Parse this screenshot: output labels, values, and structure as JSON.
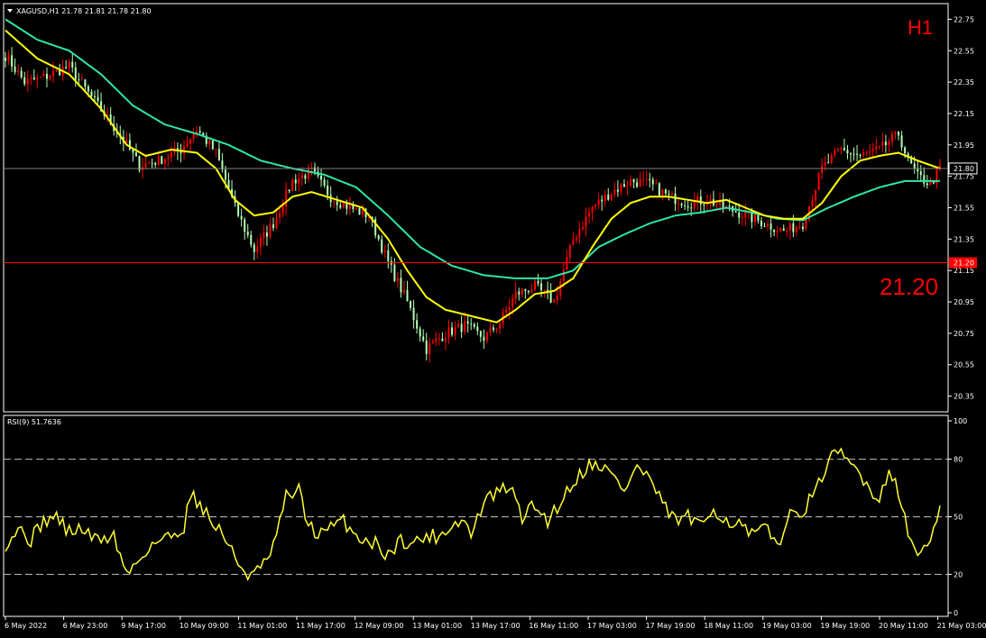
{
  "header": {
    "menu_icon": "triangle-down-icon",
    "title_text": "XAGUSD,H1  21.78 21.81 21.78 21.80"
  },
  "timeframe_label": "H1",
  "level_label": "21.20",
  "colors": {
    "background": "#000000",
    "bull": "#ff0000",
    "bear": "#b3ffb3",
    "fast_ma": "#ffff00",
    "slow_ma": "#2ee6a8",
    "rsi": "#ffff33",
    "level": "#ff0000",
    "bid": "#808080",
    "frame": "#ffffff"
  },
  "chart_data": [
    {
      "type": "line",
      "title": "XAGUSD,H1",
      "ylim": [
        20.25,
        22.85
      ],
      "y_ticks": [
        "22.75",
        "22.55",
        "22.35",
        "22.15",
        "21.95",
        "21.75",
        "21.55",
        "21.35",
        "21.15",
        "20.95",
        "20.75",
        "20.55",
        "20.35"
      ],
      "x_tick_labels": [
        "6 May 2022",
        "6 May 23:00",
        "9 May 17:00",
        "10 May 09:00",
        "11 May 01:00",
        "11 May 17:00",
        "12 May 09:00",
        "13 May 01:00",
        "13 May 17:00",
        "16 May 11:00",
        "17 May 03:00",
        "17 May 19:00",
        "18 May 11:00",
        "19 May 03:00",
        "19 May 19:00",
        "20 May 11:00",
        "21 May 03:00"
      ],
      "current_price": "21.80",
      "current_price_value": 21.8,
      "horizontal_level": "21.20",
      "horizontal_level_value": 21.2,
      "series": [
        {
          "name": "close",
          "anchors": [
            [
              0,
              22.52
            ],
            [
              6,
              22.35
            ],
            [
              12,
              22.38
            ],
            [
              20,
              22.45
            ],
            [
              26,
              22.28
            ],
            [
              32,
              22.12
            ],
            [
              38,
              21.95
            ],
            [
              42,
              21.82
            ],
            [
              48,
              21.85
            ],
            [
              55,
              21.92
            ],
            [
              60,
              22.05
            ],
            [
              66,
              21.9
            ],
            [
              72,
              21.55
            ],
            [
              78,
              21.28
            ],
            [
              84,
              21.45
            ],
            [
              90,
              21.72
            ],
            [
              96,
              21.78
            ],
            [
              102,
              21.62
            ],
            [
              108,
              21.55
            ],
            [
              114,
              21.5
            ],
            [
              120,
              21.2
            ],
            [
              126,
              20.95
            ],
            [
              132,
              20.65
            ],
            [
              138,
              20.75
            ],
            [
              144,
              20.8
            ],
            [
              150,
              20.72
            ],
            [
              155,
              20.82
            ],
            [
              160,
              21.0
            ],
            [
              166,
              21.05
            ],
            [
              172,
              20.95
            ],
            [
              178,
              21.35
            ],
            [
              184,
              21.55
            ],
            [
              190,
              21.65
            ],
            [
              196,
              21.72
            ],
            [
              202,
              21.7
            ],
            [
              208,
              21.62
            ],
            [
              214,
              21.58
            ],
            [
              220,
              21.6
            ],
            [
              226,
              21.55
            ],
            [
              232,
              21.5
            ],
            [
              238,
              21.45
            ],
            [
              244,
              21.4
            ],
            [
              250,
              21.45
            ],
            [
              256,
              21.8
            ],
            [
              262,
              21.92
            ],
            [
              268,
              21.88
            ],
            [
              274,
              21.92
            ],
            [
              280,
              22.02
            ],
            [
              283,
              21.85
            ],
            [
              286,
              21.75
            ],
            [
              290,
              21.7
            ],
            [
              293,
              21.8
            ]
          ]
        },
        {
          "name": "fast_ma",
          "anchors": [
            [
              0,
              22.68
            ],
            [
              10,
              22.5
            ],
            [
              20,
              22.4
            ],
            [
              30,
              22.18
            ],
            [
              38,
              21.95
            ],
            [
              44,
              21.88
            ],
            [
              52,
              21.92
            ],
            [
              60,
              21.9
            ],
            [
              66,
              21.8
            ],
            [
              72,
              21.6
            ],
            [
              78,
              21.5
            ],
            [
              84,
              21.52
            ],
            [
              90,
              21.62
            ],
            [
              96,
              21.65
            ],
            [
              104,
              21.6
            ],
            [
              112,
              21.55
            ],
            [
              120,
              21.35
            ],
            [
              126,
              21.15
            ],
            [
              132,
              20.98
            ],
            [
              138,
              20.9
            ],
            [
              146,
              20.86
            ],
            [
              154,
              20.82
            ],
            [
              160,
              20.9
            ],
            [
              166,
              21.0
            ],
            [
              172,
              21.02
            ],
            [
              178,
              21.1
            ],
            [
              184,
              21.3
            ],
            [
              190,
              21.48
            ],
            [
              196,
              21.58
            ],
            [
              202,
              21.62
            ],
            [
              208,
              21.62
            ],
            [
              214,
              21.6
            ],
            [
              220,
              21.58
            ],
            [
              226,
              21.6
            ],
            [
              232,
              21.55
            ],
            [
              238,
              21.5
            ],
            [
              244,
              21.48
            ],
            [
              250,
              21.48
            ],
            [
              256,
              21.58
            ],
            [
              262,
              21.75
            ],
            [
              268,
              21.85
            ],
            [
              274,
              21.88
            ],
            [
              280,
              21.9
            ],
            [
              286,
              21.85
            ],
            [
              293,
              21.8
            ]
          ]
        },
        {
          "name": "slow_ma",
          "anchors": [
            [
              0,
              22.75
            ],
            [
              10,
              22.62
            ],
            [
              20,
              22.55
            ],
            [
              30,
              22.4
            ],
            [
              40,
              22.2
            ],
            [
              50,
              22.08
            ],
            [
              60,
              22.02
            ],
            [
              70,
              21.95
            ],
            [
              80,
              21.85
            ],
            [
              90,
              21.8
            ],
            [
              100,
              21.76
            ],
            [
              110,
              21.68
            ],
            [
              120,
              21.5
            ],
            [
              130,
              21.3
            ],
            [
              140,
              21.18
            ],
            [
              150,
              21.12
            ],
            [
              160,
              21.1
            ],
            [
              170,
              21.1
            ],
            [
              178,
              21.15
            ],
            [
              186,
              21.3
            ],
            [
              194,
              21.38
            ],
            [
              202,
              21.45
            ],
            [
              210,
              21.5
            ],
            [
              218,
              21.52
            ],
            [
              226,
              21.55
            ],
            [
              234,
              21.52
            ],
            [
              242,
              21.48
            ],
            [
              250,
              21.47
            ],
            [
              258,
              21.55
            ],
            [
              266,
              21.62
            ],
            [
              274,
              21.68
            ],
            [
              282,
              21.72
            ],
            [
              293,
              21.72
            ]
          ]
        }
      ],
      "bar_count": 294
    },
    {
      "type": "line",
      "title": "RSI(9) 51.7636",
      "ylim": [
        0,
        100
      ],
      "y_ticks": [
        "100",
        "80",
        "50",
        "20",
        "0"
      ],
      "dashed_levels": [
        80,
        50,
        20
      ],
      "series": [
        {
          "name": "RSI(9)",
          "anchors": [
            [
              0,
              36
            ],
            [
              4,
              44
            ],
            [
              8,
              38
            ],
            [
              12,
              48
            ],
            [
              16,
              50
            ],
            [
              20,
              42
            ],
            [
              24,
              44
            ],
            [
              28,
              38
            ],
            [
              34,
              40
            ],
            [
              38,
              20
            ],
            [
              42,
              28
            ],
            [
              46,
              36
            ],
            [
              52,
              40
            ],
            [
              56,
              45
            ],
            [
              58,
              62
            ],
            [
              62,
              55
            ],
            [
              64,
              48
            ],
            [
              68,
              42
            ],
            [
              72,
              28
            ],
            [
              76,
              20
            ],
            [
              80,
              22
            ],
            [
              84,
              34
            ],
            [
              88,
              60
            ],
            [
              92,
              64
            ],
            [
              94,
              50
            ],
            [
              98,
              40
            ],
            [
              102,
              44
            ],
            [
              106,
              48
            ],
            [
              110,
              40
            ],
            [
              116,
              36
            ],
            [
              120,
              30
            ],
            [
              124,
              38
            ],
            [
              128,
              36
            ],
            [
              132,
              40
            ],
            [
              136,
              40
            ],
            [
              140,
              46
            ],
            [
              144,
              48
            ],
            [
              146,
              40
            ],
            [
              150,
              58
            ],
            [
              154,
              62
            ],
            [
              158,
              66
            ],
            [
              162,
              50
            ],
            [
              166,
              56
            ],
            [
              170,
              48
            ],
            [
              174,
              58
            ],
            [
              178,
              68
            ],
            [
              182,
              76
            ],
            [
              186,
              78
            ],
            [
              190,
              72
            ],
            [
              194,
              64
            ],
            [
              198,
              76
            ],
            [
              202,
              70
            ],
            [
              206,
              56
            ],
            [
              210,
              48
            ],
            [
              214,
              50
            ],
            [
              218,
              44
            ],
            [
              222,
              55
            ],
            [
              226,
              48
            ],
            [
              230,
              46
            ],
            [
              234,
              40
            ],
            [
              238,
              44
            ],
            [
              242,
              36
            ],
            [
              246,
              50
            ],
            [
              250,
              54
            ],
            [
              254,
              62
            ],
            [
              258,
              80
            ],
            [
              262,
              82
            ],
            [
              266,
              76
            ],
            [
              270,
              68
            ],
            [
              274,
              58
            ],
            [
              277,
              76
            ],
            [
              280,
              64
            ],
            [
              283,
              40
            ],
            [
              286,
              32
            ],
            [
              290,
              36
            ],
            [
              293,
              52
            ]
          ]
        }
      ]
    }
  ]
}
